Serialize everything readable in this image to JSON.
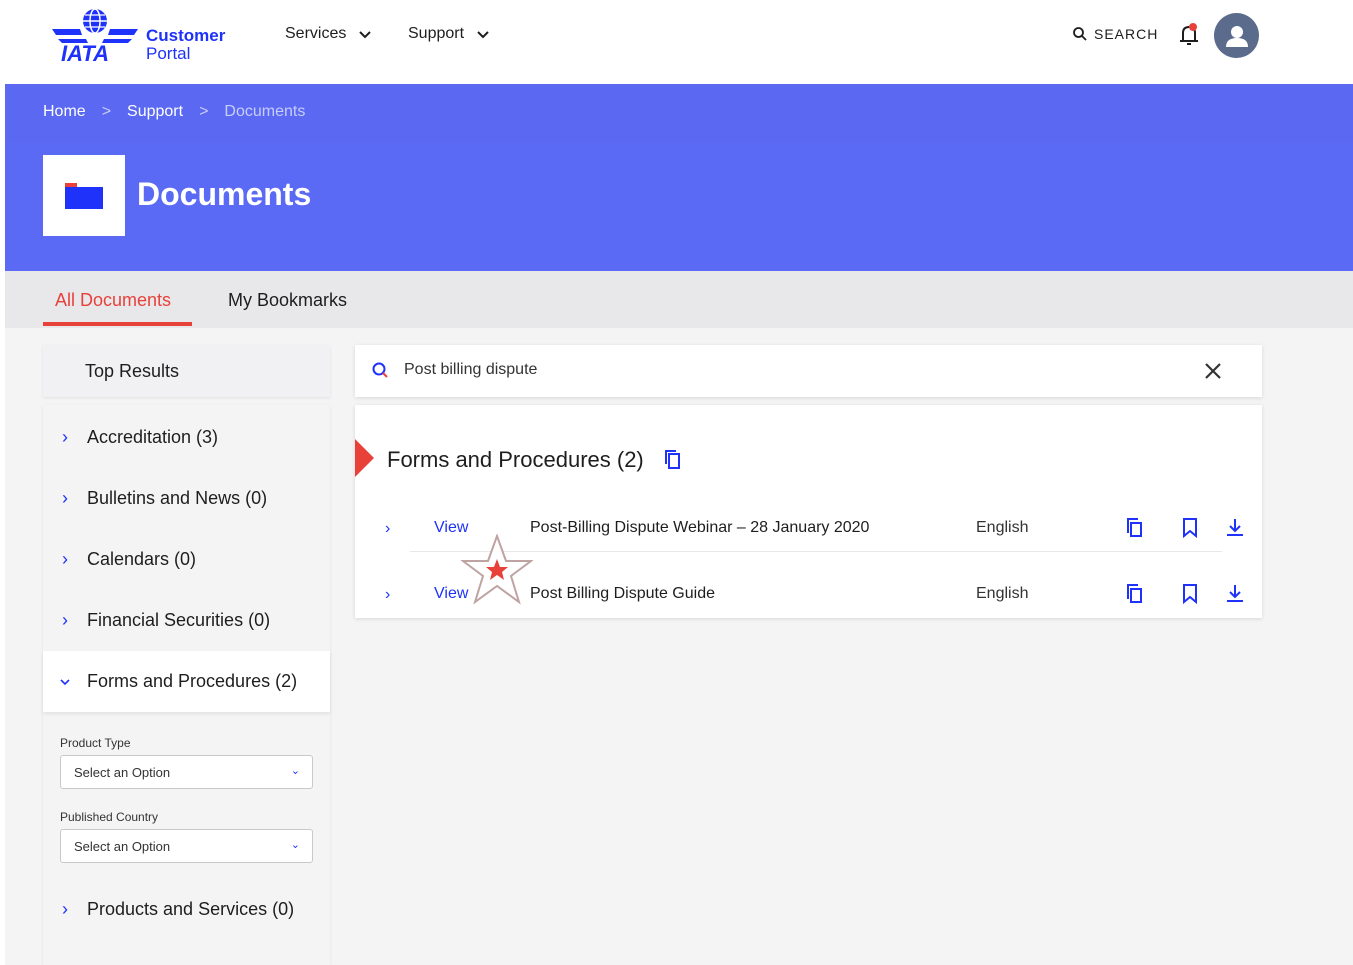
{
  "header": {
    "logo_primary": "Customer",
    "logo_secondary": "Portal",
    "logo_wordmark": "IATA",
    "nav": [
      {
        "label": "Services"
      },
      {
        "label": "Support"
      }
    ],
    "search_label": "SEARCH"
  },
  "breadcrumb": {
    "home": "Home",
    "support": "Support",
    "current": "Documents",
    "separator": ">"
  },
  "page": {
    "title": "Documents"
  },
  "tabs": {
    "all": "All Documents",
    "bookmarks": "My Bookmarks"
  },
  "sidebar": {
    "top_results": "Top Results",
    "categories": [
      {
        "label": "Accreditation (3)"
      },
      {
        "label": "Bulletins and News (0)"
      },
      {
        "label": "Calendars (0)"
      },
      {
        "label": "Financial Securities (0)"
      },
      {
        "label": "Forms and Procedures (2)"
      },
      {
        "label": "Products and Services (0)"
      }
    ],
    "filters": {
      "product_type_label": "Product Type",
      "product_type_value": "Select an Option",
      "country_label": "Published Country",
      "country_value": "Select an Option"
    }
  },
  "search": {
    "query": "Post billing dispute"
  },
  "results": {
    "section_title": "Forms and Procedures (2)",
    "rows": [
      {
        "action": "View",
        "name": "Post-Billing Dispute Webinar – 28 January 2020",
        "language": "English"
      },
      {
        "action": "View",
        "name": "Post Billing Dispute Guide",
        "language": "English"
      }
    ]
  },
  "colors": {
    "brand_blue": "#1e32fa",
    "hero_bg": "#5b6af4",
    "accent_red": "#e8413a"
  }
}
